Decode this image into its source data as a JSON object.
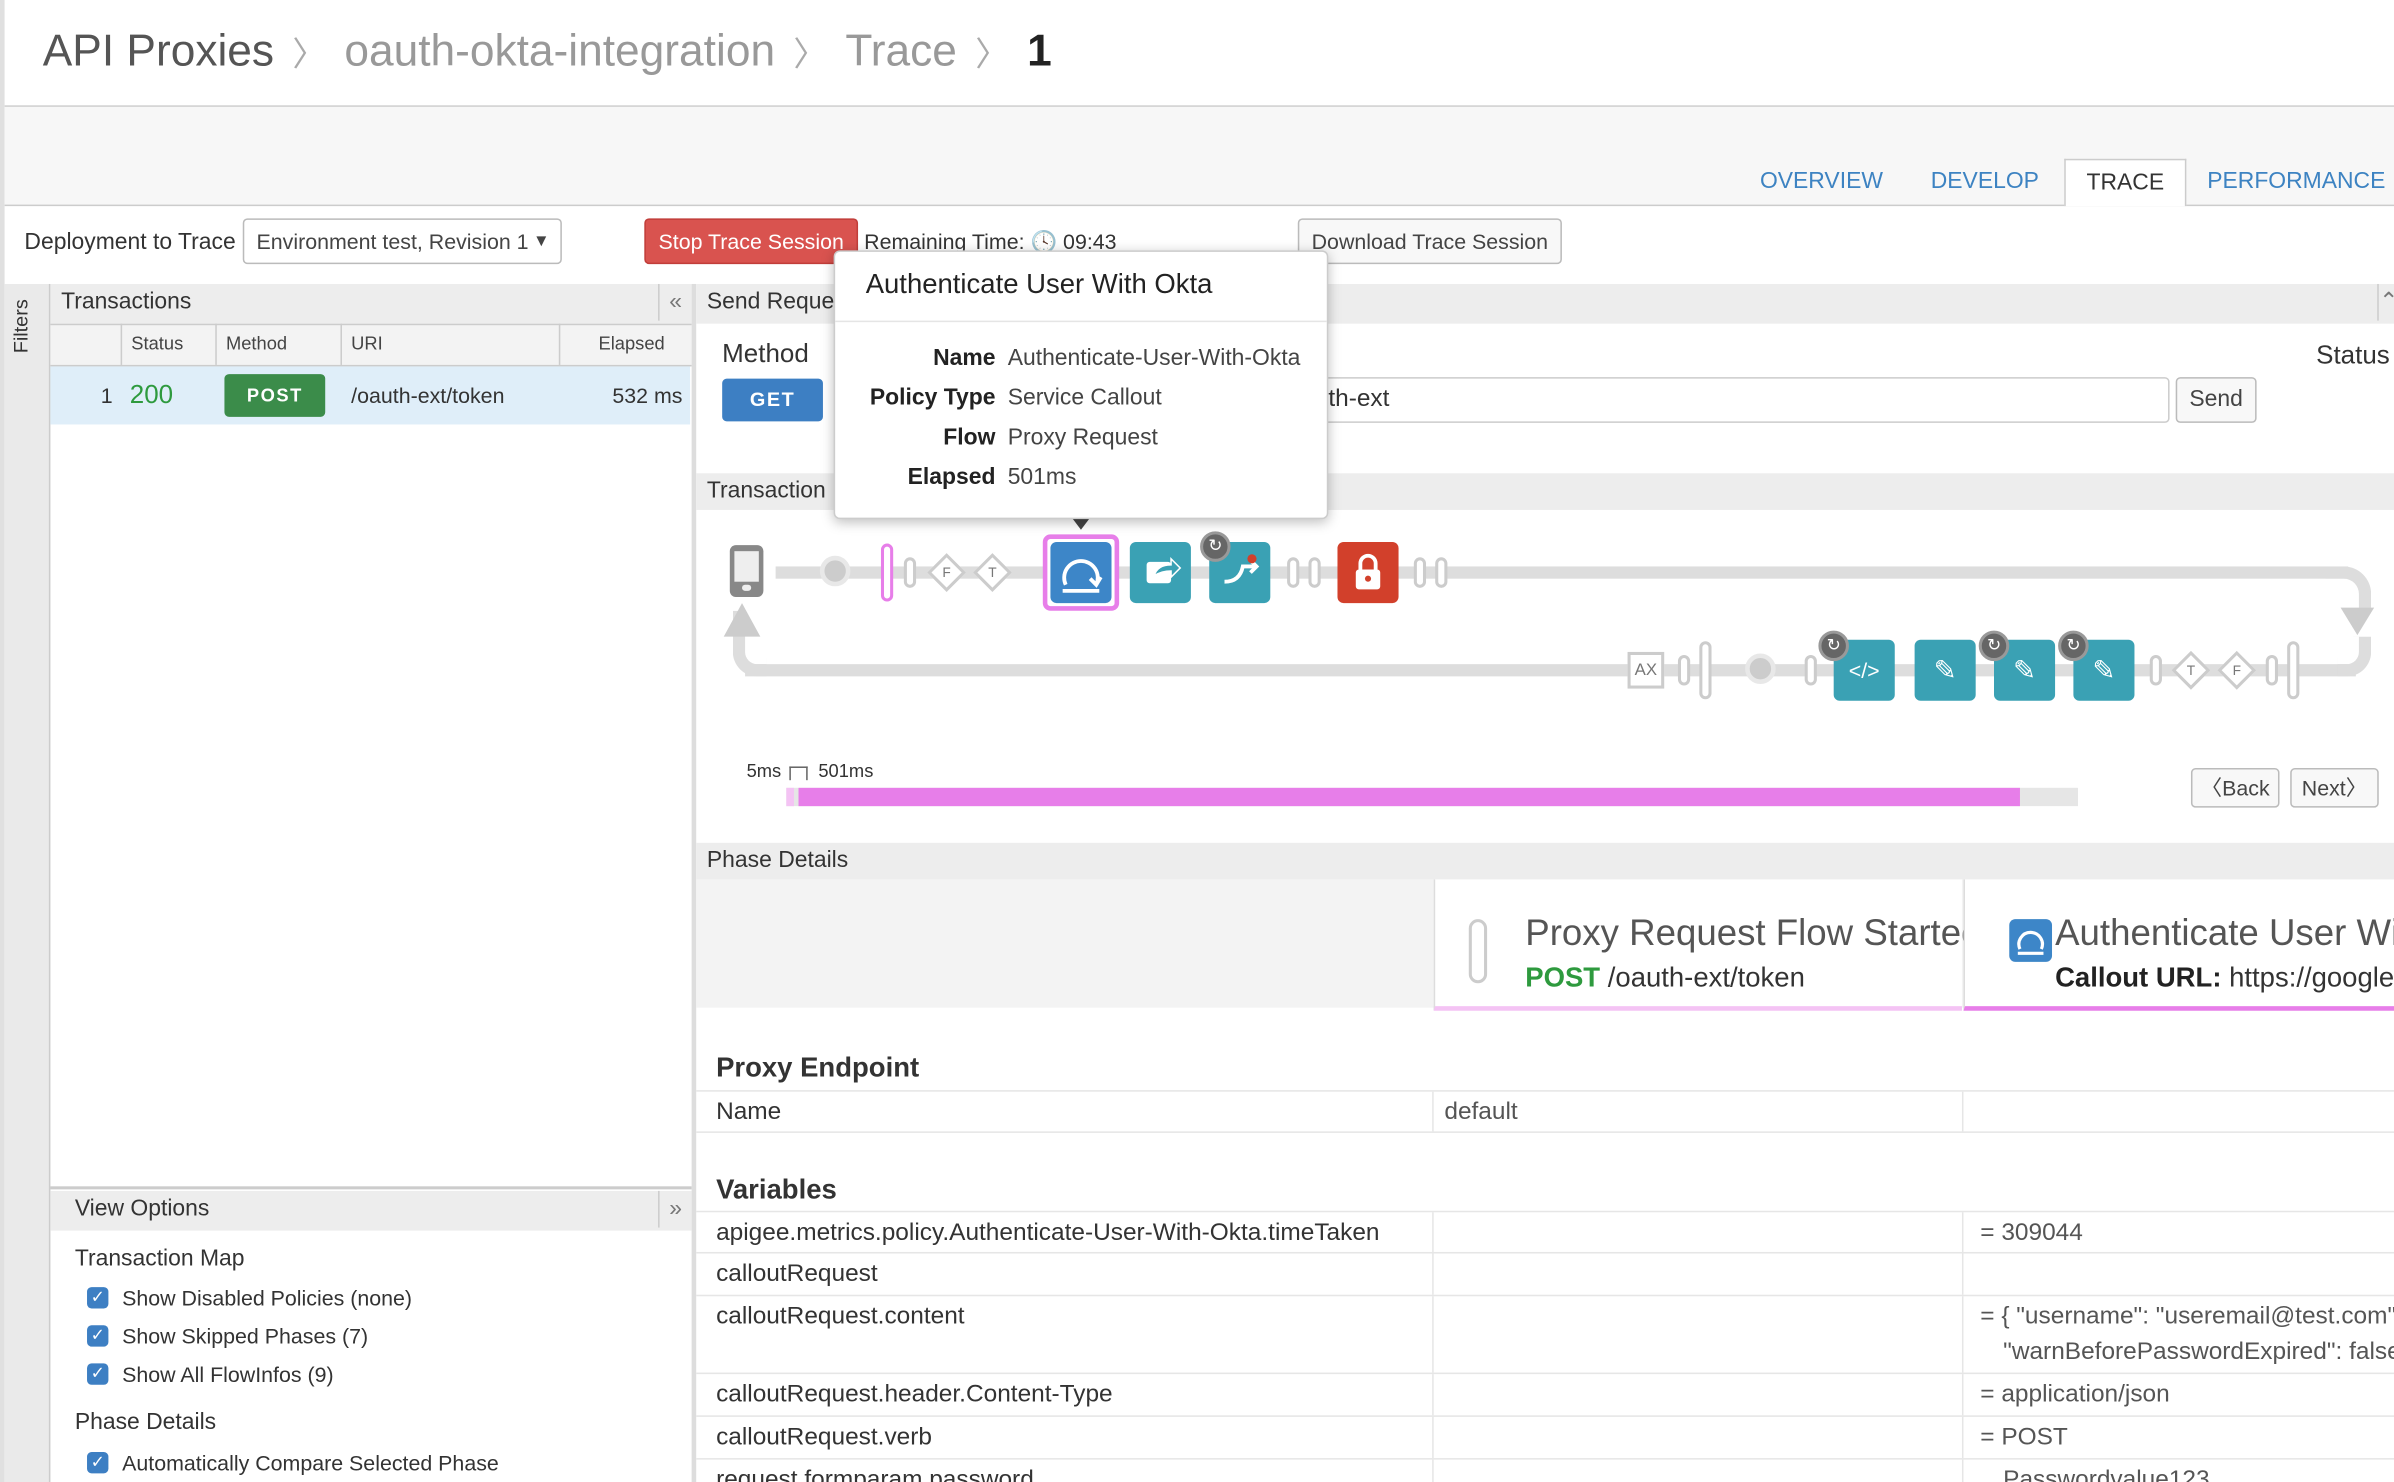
{
  "breadcrumb": {
    "items": [
      "API Proxies",
      "oauth-okta-integration",
      "Trace"
    ],
    "current": "1"
  },
  "tabs": [
    {
      "label": "OVERVIEW",
      "active": false
    },
    {
      "label": "DEVELOP",
      "active": false
    },
    {
      "label": "TRACE",
      "active": true
    },
    {
      "label": "PERFORMANCE",
      "active": false
    }
  ],
  "toolbar": {
    "deployment_label": "Deployment to Trace",
    "deployment_value": "Environment test, Revision 1",
    "stop_label": "Stop Trace Session",
    "remaining_label": "Remaining Time:",
    "remaining_value": "09:43",
    "download_label": "Download Trace Session"
  },
  "sidebar": {
    "filters_label": "Filters"
  },
  "transactions": {
    "title": "Transactions",
    "columns": [
      "Status",
      "Method",
      "URI",
      "Elapsed"
    ],
    "rows": [
      {
        "index": "1",
        "status": "200",
        "method": "POST",
        "uri": "/oauth-ext/token",
        "elapsed": "532 ms"
      }
    ]
  },
  "view_options": {
    "title": "View Options",
    "transaction_map_title": "Transaction Map",
    "transaction_map_options": [
      {
        "label": "Show Disabled Policies (none)",
        "checked": true
      },
      {
        "label": "Show Skipped Phases (7)",
        "checked": true
      },
      {
        "label": "Show All FlowInfos (9)",
        "checked": true
      }
    ],
    "phase_details_title": "Phase Details",
    "phase_details_options": [
      {
        "label": "Automatically Compare Selected Phase",
        "checked": true
      }
    ]
  },
  "send_request": {
    "title": "Send Reque",
    "method_label": "Method",
    "method_value": "GET",
    "url_value": "th-ext",
    "send_label": "Send",
    "status_label": "Status"
  },
  "transaction_map": {
    "title": "Transaction",
    "labels": {
      "f": "F",
      "t": "T",
      "ax": "AX"
    },
    "timeline": {
      "start_label": "5ms",
      "end_label": "501ms",
      "fill_fraction": 0.88
    },
    "back_label": "Back",
    "next_label": "Next"
  },
  "popover": {
    "title": "Authenticate User With Okta",
    "fields": [
      {
        "label": "Name",
        "value": "Authenticate-User-With-Okta"
      },
      {
        "label": "Policy Type",
        "value": "Service Callout"
      },
      {
        "label": "Flow",
        "value": "Proxy Request"
      },
      {
        "label": "Elapsed",
        "value": "501ms"
      }
    ]
  },
  "phase_details": {
    "title": "Phase Details",
    "phase1": {
      "title": "Proxy Request Flow Started",
      "method": "POST",
      "uri": "/oauth-ext/token"
    },
    "phase2": {
      "title": "Authenticate User Wit",
      "callout_label": "Callout URL:",
      "callout_value": "https://googlev"
    },
    "proxy_endpoint_title": "Proxy Endpoint",
    "proxy_endpoint_rows": [
      {
        "name": "Name",
        "value": "default"
      }
    ],
    "variables_title": "Variables",
    "variables": [
      {
        "name": "apigee.metrics.policy.Authenticate-User-With-Okta.timeTaken",
        "value": "= 309044"
      },
      {
        "name": "calloutRequest",
        "value": ""
      },
      {
        "name": "calloutRequest.content",
        "value": "= { \"username\": \"useremail@test.com\",",
        "value2": "\"warnBeforePasswordExpired\": false"
      },
      {
        "name": "calloutRequest.header.Content-Type",
        "value": "= application/json"
      },
      {
        "name": "calloutRequest.verb",
        "value": "= POST"
      },
      {
        "name": "request.formparam.password",
        "value": "Passwordvalue123"
      }
    ]
  },
  "colors": {
    "accent": "#3d83c2",
    "stop": "#d9534f",
    "success": "#2e9a3e",
    "post": "#3b8c4a",
    "get": "#3d7fc3",
    "policy_teal": "#3aa1b4",
    "lock_red": "#d2402b",
    "selection": "#e77ee9"
  },
  "icons": [
    "mobile-phone-icon",
    "service-callout-icon",
    "redirect-icon",
    "route-icon",
    "lock-icon",
    "xml-code-icon",
    "pencil-icon",
    "clock-icon",
    "chevron-left-icon",
    "chevron-right-icon",
    "collapse-left-icon",
    "expand-down-icon",
    "collapse-up-icon",
    "caret-down-icon"
  ]
}
